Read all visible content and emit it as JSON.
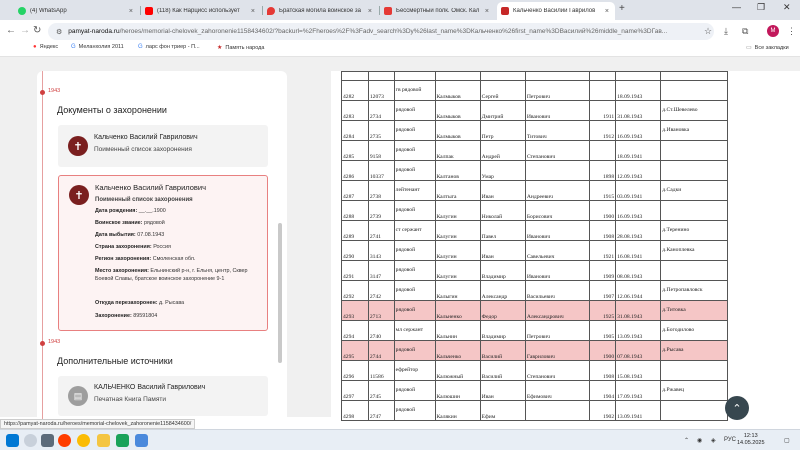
{
  "browser": {
    "tabs": [
      {
        "label": "(4) WhatsApp",
        "color": "#25d366"
      },
      {
        "label": "(118) Как Нарцисс использует",
        "color": "#ff0000"
      },
      {
        "label": "Братская могила воинское за",
        "color": "#e53935"
      },
      {
        "label": "Бессмертный полк. Омск. Кал",
        "color": "#e53935"
      },
      {
        "label": "Кальченко Василий Гаврилов",
        "color": "#c62828"
      }
    ],
    "new_tab": "+",
    "url_domain": "pamyat-naroda.ru",
    "url_rest": "/heroes/memorial-chelovek_zahoronenie1158434602/?backurl=%2Fheroes%2F%3Fadv_search%3Dy%26last_name%3DКальченко%26first_name%3DВасилий%26middle_name%3DГав...",
    "avatar_letter": "M",
    "bookmarks": [
      {
        "label": "Яндекс",
        "icon": "y"
      },
      {
        "label": "Меланхолия 2011",
        "icon": "G"
      },
      {
        "label": "ларс фон триер - П...",
        "icon": "G"
      },
      {
        "label": "Память народа",
        "icon": "star"
      }
    ],
    "all_bookmarks": "Все закладки",
    "status_url": "https://pamyat-naroda.ru/heroes/memorial-chelovek_zahoronenie1158434600/"
  },
  "left_panel": {
    "year_top": "1943",
    "docs_heading": "Документы о захоронении",
    "entry1": {
      "name": "Кальченко Василий Гаврилович",
      "sub": "Поименный список захоронения"
    },
    "entry2": {
      "name": "Кальченко Василий Гаврилович",
      "sub": "Поименный список захоронения",
      "fields": [
        {
          "label": "Дата рождения:",
          "value": "__.__.1900"
        },
        {
          "label": "Воинское звание:",
          "value": "рядовой"
        },
        {
          "label": "Дата выбытия:",
          "value": "07.08.1943"
        },
        {
          "label": "Страна захоронения:",
          "value": "Россия"
        },
        {
          "label": "Регион захоронения:",
          "value": "Смоленская обл."
        },
        {
          "label": "Место захоронения:",
          "value": "Ельнинский р-н, г. Ельня, центр, Сквер Боевой Славы, братское воинское захоронение 9-1"
        },
        {
          "label": "Откуда перезахоронен:",
          "value": "д. Рысава"
        },
        {
          "label": "Захоронение:",
          "value": "89591804"
        }
      ]
    },
    "year_mid": "1943",
    "extra_heading": "Дополнительные источники",
    "entry3": {
      "name": "КАЛЬЧЕНКО Василий Гаврилович",
      "sub": "Печатная Книга Памяти"
    }
  },
  "register": {
    "rows": [
      [
        "4282",
        "12073",
        "гв рядовой",
        "Калмыков",
        "Сергей",
        "Петрович",
        "",
        "18.09.1943",
        ""
      ],
      [
        "4283",
        "2734",
        "рядовой",
        "Калмыков",
        "Дмитрий",
        "Иванович",
        "1911",
        "31.08.1943",
        "д.Ст.Шевелево"
      ],
      [
        "4284",
        "2735",
        "рядовой",
        "Калмыков",
        "Петр",
        "Титович",
        "1912",
        "16.09.1943",
        "д.Ивановка"
      ],
      [
        "4285",
        "9158",
        "рядовой",
        "Калпак",
        "Андрей",
        "Степанович",
        "",
        "18.09.1941",
        ""
      ],
      [
        "4286",
        "10337",
        "рядовой",
        "Калтанов",
        "Умар",
        "",
        "1898",
        "12.09.1943",
        ""
      ],
      [
        "4287",
        "2738",
        "лейтенант",
        "Калтыга",
        "Иван",
        "Андреевич",
        "1915",
        "03.09.1941",
        "д.Садки"
      ],
      [
        "4288",
        "2739",
        "рядовой",
        "Калугин",
        "Николай",
        "Борисович",
        "1900",
        "16.09.1943",
        ""
      ],
      [
        "4289",
        "2741",
        "ст сержант",
        "Калугин",
        "Павел",
        "Иванович",
        "1908",
        "28.08.1943",
        "д.Теренино"
      ],
      [
        "4290",
        "3143",
        "рядовой",
        "Калугин",
        "Иван",
        "Савельевич",
        "1921",
        "16.08.1941",
        "д.Каноплевка"
      ],
      [
        "4291",
        "3147",
        "рядовой",
        "Калугин",
        "Владимир",
        "Иванович",
        "1909",
        "08.08.1943",
        ""
      ],
      [
        "4292",
        "2742",
        "рядовой",
        "Калыгин",
        "Александр",
        "Васильевич",
        "1907",
        "12.06.1944",
        "д.Петропавловск"
      ],
      [
        "4293",
        "2713",
        "рядовой",
        "Кальненко",
        "Федор",
        "Александрович",
        "1925",
        "31.08.1943",
        "д.Титовка"
      ],
      [
        "4294",
        "2740",
        "мл сержант",
        "Кальнин",
        "Владимир",
        "Петрович",
        "1905",
        "13.09.1943",
        "д.Богодилово"
      ],
      [
        "4295",
        "2744",
        "рядовой",
        "Кальченко",
        "Василий",
        "Гаврилович",
        "1900",
        "07.08.1943",
        "д.Рысава"
      ],
      [
        "4296",
        "11586",
        "ефрейтор",
        "Калюжный",
        "Василий",
        "Степанович",
        "1908",
        "15.08.1943",
        ""
      ],
      [
        "4297",
        "2745",
        "рядовой",
        "Калюшин",
        "Иван",
        "Ефимович",
        "1904",
        "17.09.1943",
        "д.Ржавец"
      ],
      [
        "4298",
        "2747",
        "рядовой",
        "Калякин",
        "Ефим",
        "",
        "1902",
        "13.09.1941",
        ""
      ]
    ],
    "highlight_rows": [
      11,
      13
    ]
  },
  "taskbar": {
    "lang": "РУС",
    "time": "12:13",
    "date": "14.05.2025"
  }
}
